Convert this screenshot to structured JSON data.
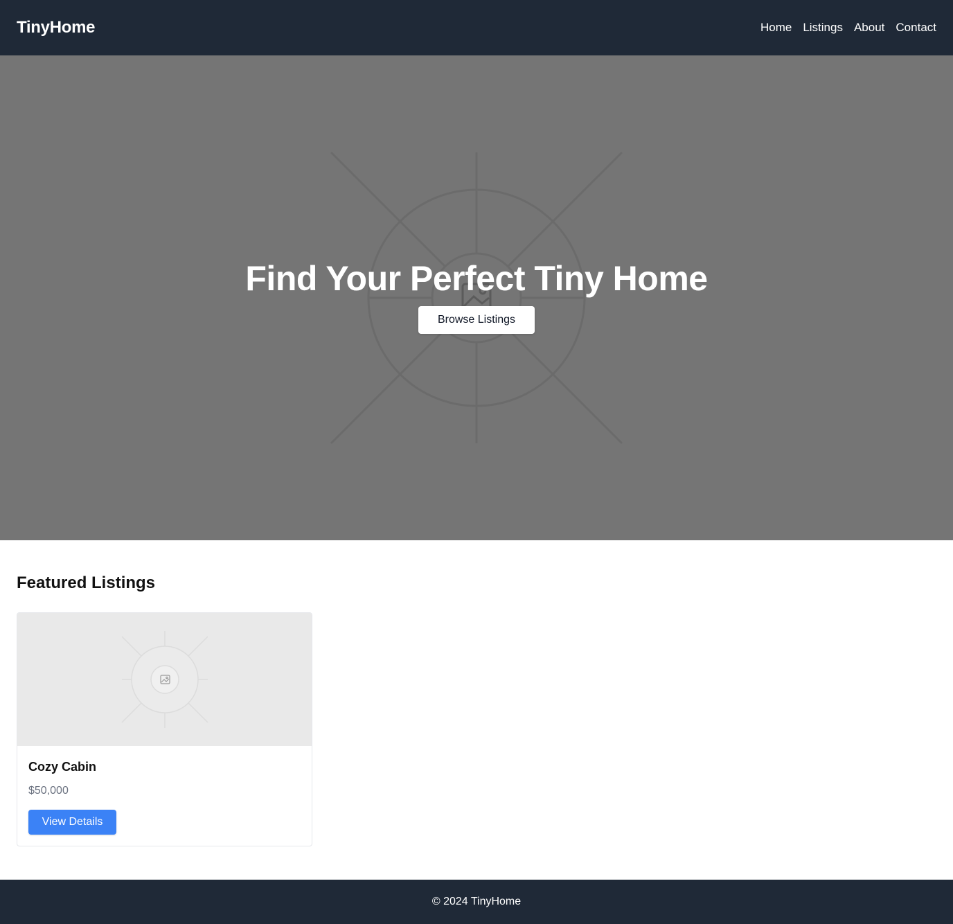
{
  "header": {
    "brand": "TinyHome",
    "nav": [
      {
        "label": "Home"
      },
      {
        "label": "Listings"
      },
      {
        "label": "About"
      },
      {
        "label": "Contact"
      }
    ]
  },
  "hero": {
    "title": "Find Your Perfect Tiny Home",
    "button_label": "Browse Listings",
    "image_icon": "image-placeholder-icon"
  },
  "featured": {
    "title": "Featured Listings",
    "listings": [
      {
        "title": "Cozy Cabin",
        "price": "$50,000",
        "button_label": "View Details",
        "image_icon": "image-placeholder-icon"
      }
    ]
  },
  "footer": {
    "text": "© 2024 TinyHome"
  },
  "colors": {
    "header_bg": "#1f2937",
    "hero_bg": "#757575",
    "accent": "#3b82f6",
    "muted_text": "#6b7280"
  }
}
